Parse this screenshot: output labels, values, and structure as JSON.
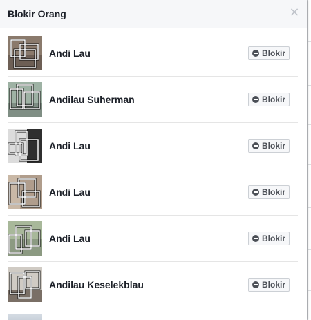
{
  "dialog": {
    "title": "Blokir Orang",
    "close_glyph": "×"
  },
  "people": [
    {
      "name": "Andi Lau",
      "block_label": "Blokir"
    },
    {
      "name": "Andilau Suherman",
      "block_label": "Blokir"
    },
    {
      "name": "Andi Lau",
      "block_label": "Blokir"
    },
    {
      "name": "Andi Lau",
      "block_label": "Blokir"
    },
    {
      "name": "Andi Lau",
      "block_label": "Blokir"
    },
    {
      "name": "Andilau Keselekblau",
      "block_label": "Blokir"
    }
  ],
  "icons": {
    "close": "close-icon",
    "block": "block-minus-icon"
  },
  "colors": {
    "header_bg": "#f6f7f9",
    "text": "#1d2129",
    "button_bg": "#f6f7f9",
    "button_border": "#ccd0d5"
  }
}
